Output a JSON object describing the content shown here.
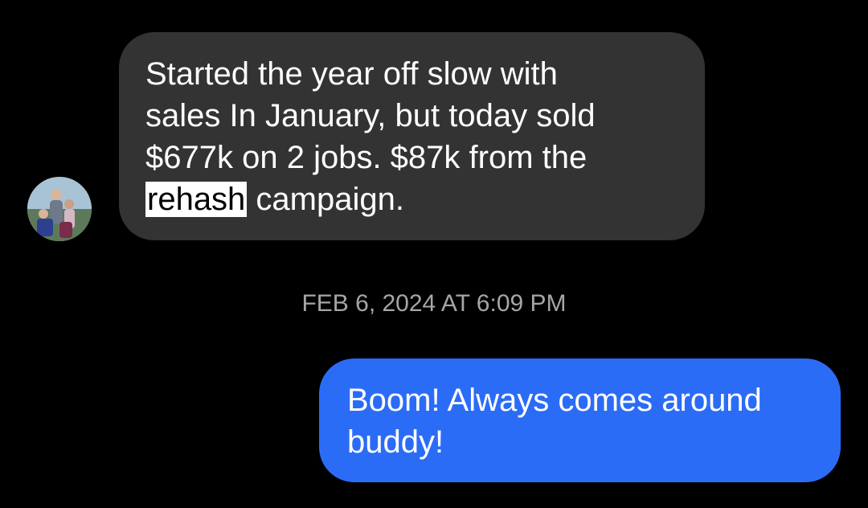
{
  "thread": {
    "incoming": {
      "avatar_icon": "contact-avatar-photo",
      "lines": [
        "Started the year off slow with",
        "sales In January, but today sold",
        "$677k on 2 jobs. $87k from the"
      ],
      "highlight_word": "rehash",
      "last_line_rest": " campaign.",
      "bubble_color": "#333333"
    },
    "timestamp": "FEB 6, 2024 AT 6:09 PM",
    "outgoing": {
      "lines": [
        "Boom! Always comes around",
        "buddy!"
      ],
      "bubble_color": "#2b6cf7"
    }
  }
}
